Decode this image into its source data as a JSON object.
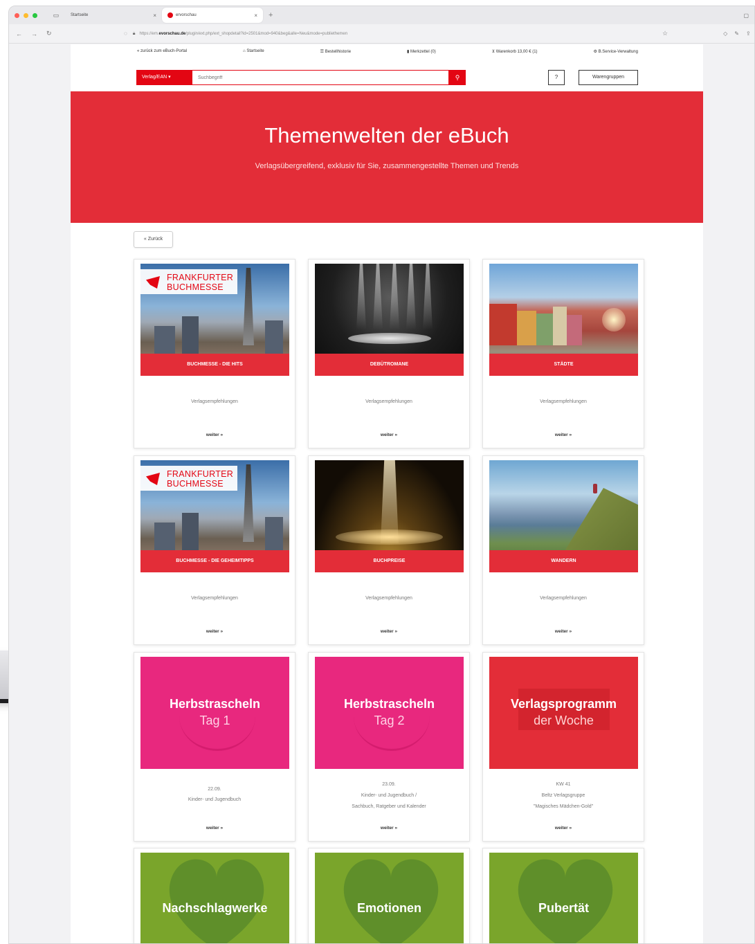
{
  "browser": {
    "tabs": [
      {
        "title": "Startseite",
        "active": false
      },
      {
        "title": "ervorschau",
        "active": true
      }
    ],
    "new_tab": "+",
    "url_prefix": "https://em.",
    "url_domain": "evorschau.de",
    "url_rest": "/plugin/ext.php/ext_shopdetail?id=2501&mod=940&beg&alle=Neu&mode=publiethemen"
  },
  "topnav": {
    "back": "« zurück zum eBuch-Portal",
    "home": "Startseite",
    "orders": "Bestellhistorie",
    "notes": "Merkzettel (0)",
    "cart": "Warenkorb 13,00 € (1)",
    "service": "B.Service-Verwaltung"
  },
  "search": {
    "select_label": "Verlag/EAN",
    "placeholder": "Suchbegriff",
    "help": "?",
    "groups": "Warengruppen"
  },
  "hero": {
    "title": "Themenwelten der eBuch",
    "subtitle": "Verlagsübergreifend, exklusiv für Sie, zusammengestellte Themen und Trends",
    "color": "#e32d38"
  },
  "back_button": "« Zurück",
  "logo_text": "FRANKFURTER BUCHMESSE",
  "cards": [
    {
      "banner": "BUCHMESSE - DIE HITS",
      "sub": [
        "Verlagsempfehlungen"
      ],
      "more": "weiter »"
    },
    {
      "banner": "DEBÜTROMANE",
      "sub": [
        "Verlagsempfehlungen"
      ],
      "more": "weiter »"
    },
    {
      "banner": "STÄDTE",
      "sub": [
        "Verlagsempfehlungen"
      ],
      "more": "weiter »"
    },
    {
      "banner": "BUCHMESSE - DIE GEHEIMTIPPS",
      "sub": [
        "Verlagsempfehlungen"
      ],
      "more": "weiter »"
    },
    {
      "banner": "BUCHPREISE",
      "sub": [
        "Verlagsempfehlungen"
      ],
      "more": "weiter »"
    },
    {
      "banner": "WANDERN",
      "sub": [
        "Verlagsempfehlungen"
      ],
      "more": "weiter »"
    },
    {
      "tile_title": "Herbstrascheln",
      "tile_sub": "Tag 1",
      "sub": [
        "22.09.",
        "Kinder- und Jugendbuch"
      ],
      "more": "weiter »"
    },
    {
      "tile_title": "Herbstrascheln",
      "tile_sub": "Tag 2",
      "sub": [
        "23.09.",
        "Kinder- und Jugendbuch /",
        "Sachbuch, Ratgeber und Kalender"
      ],
      "more": "weiter »"
    },
    {
      "tile_title": "Verlagsprogramm",
      "tile_sub": "der Woche",
      "sub": [
        "KW 41",
        "Beltz Verlagsgruppe",
        "\"Magisches Mädchen-Gold\""
      ],
      "more": "weiter »"
    },
    {
      "tile_title": "Nachschlagwerke"
    },
    {
      "tile_title": "Emotionen"
    },
    {
      "tile_title": "Pubertät"
    }
  ]
}
